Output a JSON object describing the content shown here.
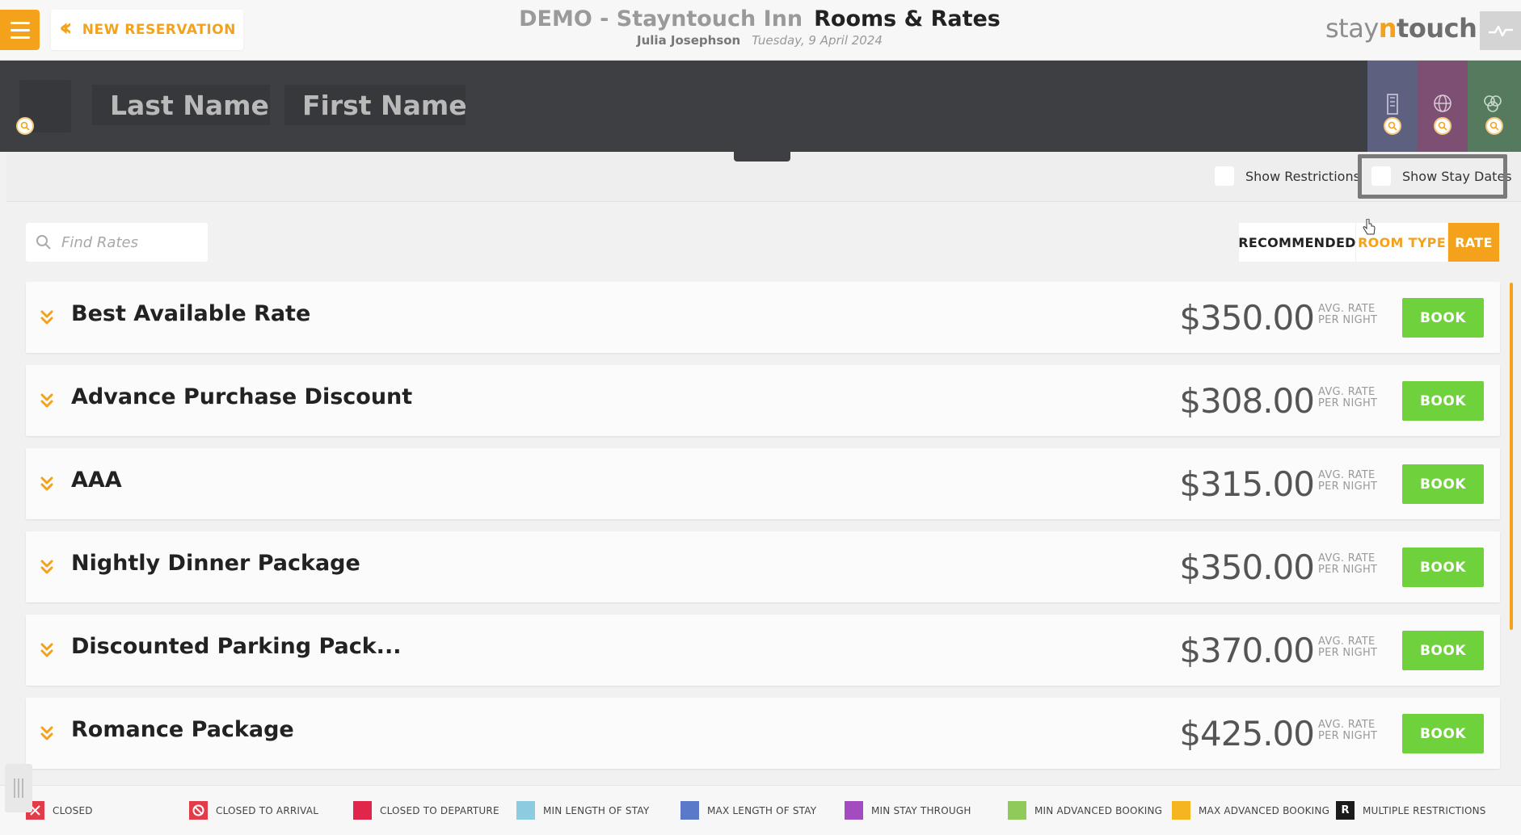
{
  "header": {
    "back_label": "NEW RESERVATION",
    "hotel_name": "DEMO - Stayntouch Inn",
    "page_title": "Rooms & Rates",
    "user_name": "Julia Josephson",
    "business_date": "Tuesday, 9 April 2024",
    "logo": {
      "part1": "stay",
      "part2": "n",
      "part3": "touch"
    }
  },
  "search": {
    "last_name_placeholder": "Last Name",
    "first_name_placeholder": "First Name"
  },
  "toggles": {
    "show_restrictions": "Show Restrictions",
    "show_stay_dates": "Show Stay Dates"
  },
  "filter": {
    "find_rates_placeholder": "Find Rates",
    "tabs": [
      {
        "label": "RECOMMENDED",
        "active": false
      },
      {
        "label": "ROOM TYPE",
        "active": false
      },
      {
        "label": "RATE",
        "active": true
      }
    ]
  },
  "rates": [
    {
      "name": "Best Available Rate",
      "price": "$350.00",
      "avg_line1": "AVG. RATE",
      "avg_line2": "PER NIGHT",
      "book": "BOOK"
    },
    {
      "name": "Advance Purchase Discount",
      "price": "$308.00",
      "avg_line1": "AVG. RATE",
      "avg_line2": "PER NIGHT",
      "book": "BOOK"
    },
    {
      "name": "AAA",
      "price": "$315.00",
      "avg_line1": "AVG. RATE",
      "avg_line2": "PER NIGHT",
      "book": "BOOK"
    },
    {
      "name": "Nightly Dinner Package",
      "price": "$350.00",
      "avg_line1": "AVG. RATE",
      "avg_line2": "PER NIGHT",
      "book": "BOOK"
    },
    {
      "name": "Discounted Parking Pack...",
      "price": "$370.00",
      "avg_line1": "AVG. RATE",
      "avg_line2": "PER NIGHT",
      "book": "BOOK"
    },
    {
      "name": "Romance Package",
      "price": "$425.00",
      "avg_line1": "AVG. RATE",
      "avg_line2": "PER NIGHT",
      "book": "BOOK"
    }
  ],
  "legend": [
    {
      "label": "CLOSED",
      "color": "#e23b4a",
      "icon": "x-icon"
    },
    {
      "label": "CLOSED TO ARRIVAL",
      "color": "#e23b4a",
      "icon": "no-entry-icon"
    },
    {
      "label": "CLOSED TO DEPARTURE",
      "color": "#e0264a",
      "icon": ""
    },
    {
      "label": "MIN LENGTH OF STAY",
      "color": "#8ccbe0",
      "icon": ""
    },
    {
      "label": "MAX LENGTH OF STAY",
      "color": "#5a7ac9",
      "icon": ""
    },
    {
      "label": "MIN STAY THROUGH",
      "color": "#a24cc0",
      "icon": ""
    },
    {
      "label": "MIN ADVANCED BOOKING",
      "color": "#8fca5a",
      "icon": ""
    },
    {
      "label": "MAX ADVANCED BOOKING",
      "color": "#f4b520",
      "icon": ""
    },
    {
      "label": "MULTIPLE RESTRICTIONS",
      "color": "#1b1b1b",
      "icon": "R"
    }
  ],
  "colors": {
    "accent": "#f4a21c",
    "book_green": "#6fd13b",
    "header_dark": "#3d3f42",
    "tab_building": "#5e6080",
    "tab_globe": "#7d4f72",
    "tab_group": "#557a5e"
  }
}
